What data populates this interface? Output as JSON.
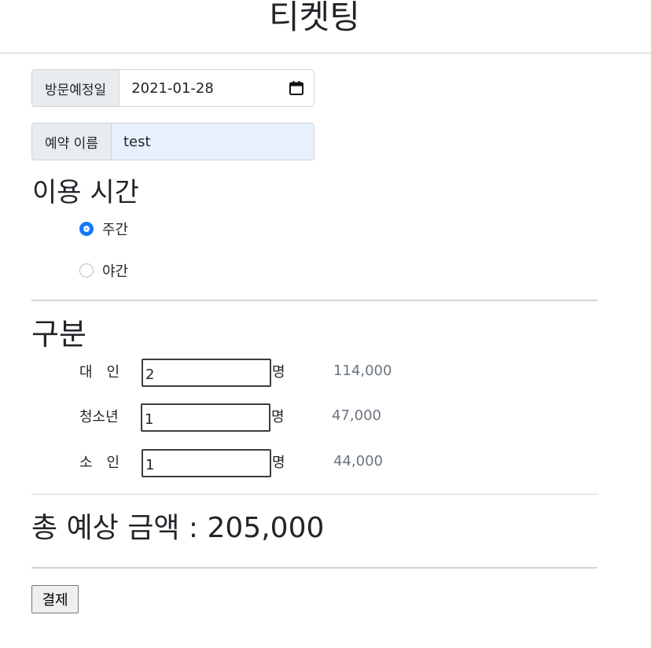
{
  "page": {
    "title": "티켓팅"
  },
  "visit_date": {
    "label": "방문예정일",
    "value": "2021-01-28"
  },
  "reservation_name": {
    "label": "예약 이름",
    "value": "test"
  },
  "usage_time": {
    "heading": "이용 시간",
    "options": [
      {
        "label": "주간",
        "selected": true
      },
      {
        "label": "야간",
        "selected": false
      }
    ]
  },
  "category": {
    "heading": "구분",
    "unit": "명",
    "rows": [
      {
        "label": "대　인",
        "quantity": "2",
        "price": "114,000"
      },
      {
        "label": "청소년",
        "quantity": "1",
        "price": "47,000"
      },
      {
        "label": "소　인",
        "quantity": "1",
        "price": "44,000"
      }
    ]
  },
  "total": {
    "text": "총 예상 금액 : 205,000"
  },
  "payment": {
    "button_label": "결제"
  },
  "colors": {
    "radio_accent": "#1677ff",
    "autofill_bg": "#e8f0fe",
    "addon_bg": "#e9ecef"
  }
}
